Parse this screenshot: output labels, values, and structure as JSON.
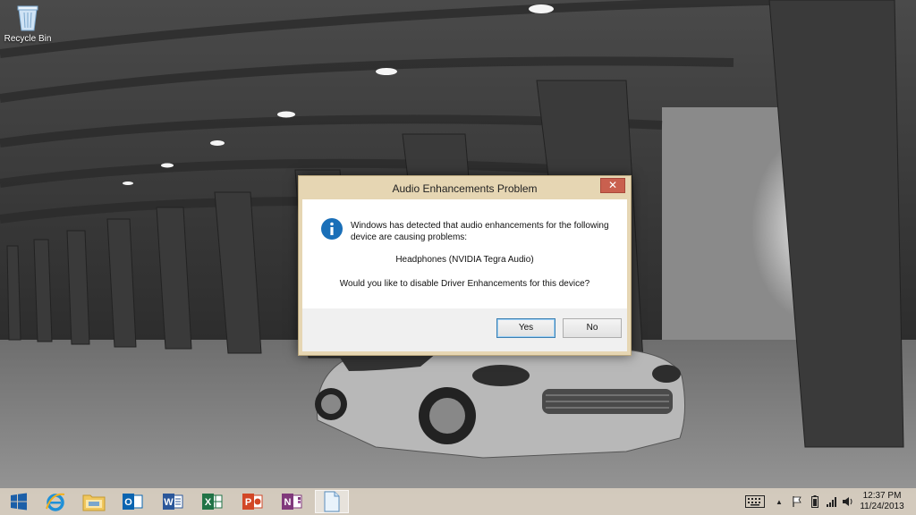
{
  "desktop": {
    "recycle_bin_label": "Recycle Bin"
  },
  "dialog": {
    "title": "Audio Enhancements Problem",
    "close_label": "✕",
    "message": "Windows has detected that audio enhancements for the following device are causing problems:",
    "device": "Headphones (NVIDIA Tegra Audio)",
    "question": "Would you like to disable Driver Enhancements for this device?",
    "yes_label": "Yes",
    "no_label": "No"
  },
  "taskbar": {
    "apps": [
      {
        "name": "start",
        "icon": "windows-logo-icon"
      },
      {
        "name": "internet-explorer",
        "icon": "internet-explorer-icon"
      },
      {
        "name": "file-explorer",
        "icon": "folder-icon"
      },
      {
        "name": "outlook",
        "icon": "outlook-icon",
        "letter": "O"
      },
      {
        "name": "word",
        "icon": "word-icon",
        "letter": "W"
      },
      {
        "name": "excel",
        "icon": "excel-icon",
        "letter": "X"
      },
      {
        "name": "powerpoint",
        "icon": "powerpoint-icon",
        "letter": "P"
      },
      {
        "name": "onenote",
        "icon": "onenote-icon",
        "letter": "N"
      },
      {
        "name": "notepad",
        "icon": "document-icon",
        "active": true
      }
    ],
    "tray": {
      "keyboard_icon": "keyboard-icon",
      "chevron": "▲",
      "flag_icon": "flag-icon",
      "battery_icon": "battery-icon",
      "signal_icon": "signal-icon",
      "volume_icon": "volume-icon"
    },
    "clock": {
      "time": "12:37 PM",
      "date": "11/24/2013"
    }
  },
  "colors": {
    "dialog_frame": "#e6d6b3",
    "close_button": "#c9604f",
    "info_blue": "#1a6fb8",
    "taskbar": "#d7cdc0"
  }
}
